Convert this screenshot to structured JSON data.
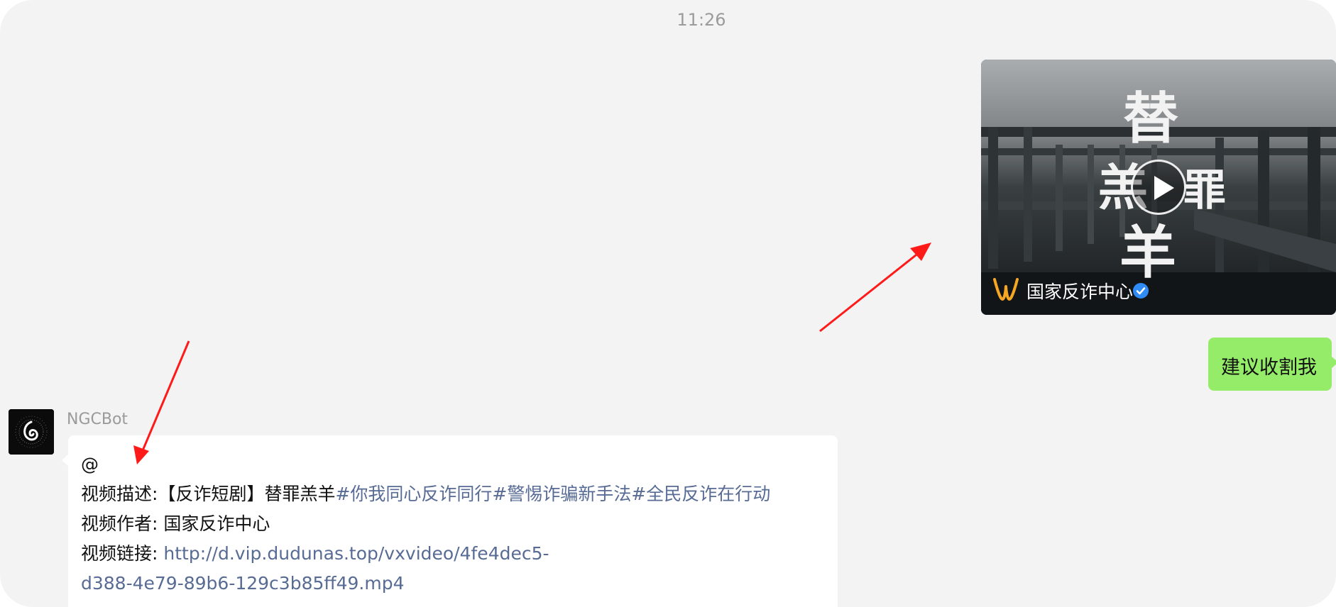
{
  "timestamp": "11:26",
  "video_card": {
    "title_art": "替罪羔羊",
    "channel_name": "国家反诈中心",
    "channel_logo_icon": "channels-logo-icon",
    "verified_icon": "verified-badge-icon",
    "play_icon": "play-icon"
  },
  "outgoing_message": {
    "text": "建议收割我"
  },
  "incoming_message": {
    "sender": "NGCBot",
    "avatar_icon": "spiral-avatar-icon",
    "mention": "@",
    "desc_label": "视频描述:",
    "desc_text": "【反诈短剧】替罪羔羊",
    "desc_tags": "#你我同心反诈同行#警惕诈骗新手法#全民反诈在行动",
    "author_label": "视频作者:",
    "author_text": "国家反诈中心",
    "link_label": "视频链接:",
    "link_part1": "http://d.vip.dudunas.top/vxvideo/4fe4dec5-",
    "link_part2": "d388-4e79-89b6-129c3b85ff49.mp4"
  },
  "colors": {
    "background": "#f3f3f3",
    "outgoing_bubble": "#95ec69",
    "incoming_bubble": "#ffffff",
    "link": "#576b95",
    "annotation_arrow": "#ff1a1a"
  }
}
